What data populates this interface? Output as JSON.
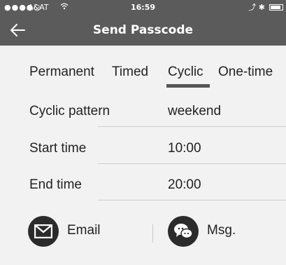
{
  "status_bar": {
    "signal": "●●●●○",
    "carrier": "A&AT",
    "wifi_icon": "wifi-icon",
    "time": "16:59",
    "right_icons": "⤴ ✱",
    "battery_icon": "battery-icon"
  },
  "nav": {
    "title": "Send Passcode",
    "back_icon": "back-arrow-icon"
  },
  "tabs": [
    {
      "label": "Permanent"
    },
    {
      "label": "Timed"
    },
    {
      "label": "Cyclic"
    },
    {
      "label": "One-time"
    }
  ],
  "selected_tab": "Cyclic",
  "form": {
    "cyclic_pattern": {
      "label": "Cyclic pattern",
      "value": "weekend"
    },
    "start_time": {
      "label": "Start time",
      "value": "10:00"
    },
    "end_time": {
      "label": "End time",
      "value": "20:00"
    }
  },
  "actions": {
    "email": {
      "label": "Email",
      "icon": "envelope-icon"
    },
    "msg": {
      "label": "Msg.",
      "icon": "chat-bubbles-icon"
    }
  },
  "colors": {
    "topbar": "#5b5b5b",
    "background": "#f2f2f2",
    "icon_circle": "#2b2b2b",
    "selected_underline": "#555555"
  }
}
